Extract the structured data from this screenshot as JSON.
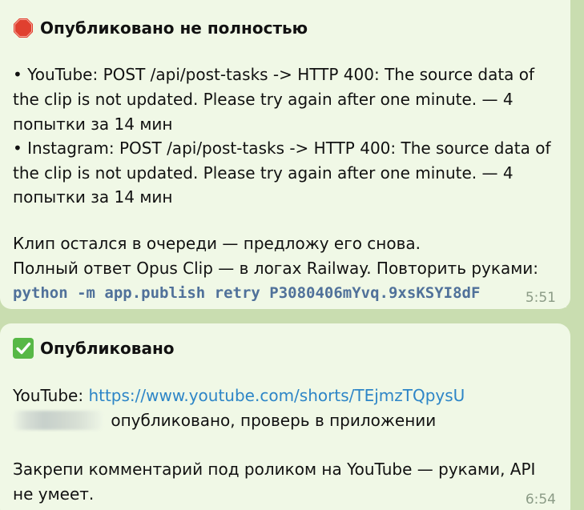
{
  "messages": [
    {
      "icon": "stop-sign-icon",
      "title": "Опубликовано не полностью",
      "lines": [
        "• YouTube: POST /api/post-tasks -> HTTP 400: The source data of",
        "the clip is not updated. Please try again after one minute. — 4",
        "попытки за 14 мин",
        "• Instagram: POST /api/post-tasks -> HTTP 400: The source data of",
        "the clip is not updated. Please try again after one minute. — 4",
        "попытки за 14 мин"
      ],
      "note_line1": "Клип остался в очереди — предложу его снова.",
      "note_line2": "Полный ответ Opus Clip — в логах Railway. Повторить руками:",
      "command": "python -m app.publish retry P3080406mYvq.9xsKSYI8dF",
      "time": "5:51"
    },
    {
      "icon": "check-mark-icon",
      "title": "Опубликовано",
      "youtube_label": "YouTube: ",
      "youtube_link": "https://www.youtube.com/shorts/TEjmzTQpysU",
      "hidden_suffix": "опубликовано, проверь в приложении",
      "pin_line1": "Закрепи комментарий под роликом на YouTube — руками, API",
      "pin_line2": "не умеет.",
      "time": "6:54"
    }
  ],
  "colors": {
    "background": "#c9ddb0",
    "bubble": "#f0f8e6",
    "code": "#50719a",
    "link": "#2d85c7",
    "time": "#8b9b86",
    "stop": "#e0402f",
    "check": "#57b846"
  }
}
